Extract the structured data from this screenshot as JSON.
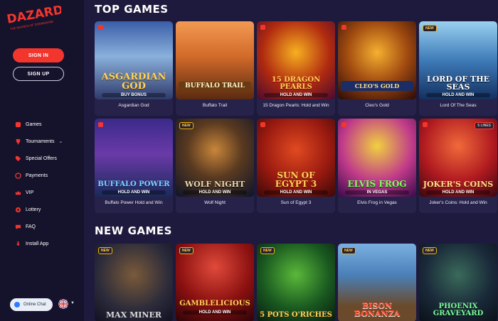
{
  "brand": {
    "name": "DAZARD",
    "tagline": "THE RAVINGS OF DONNRAVINE",
    "accent": "#f2362e"
  },
  "auth": {
    "signin_label": "SIGN IN",
    "signup_label": "SIGN UP"
  },
  "nav": [
    {
      "label": "Games",
      "icon": "dice-icon"
    },
    {
      "label": "Tournaments",
      "icon": "trophy-icon"
    },
    {
      "label": "Special Offers",
      "icon": "tag-icon"
    },
    {
      "label": "Payments",
      "icon": "wallet-icon"
    },
    {
      "label": "VIP",
      "icon": "crown-icon"
    },
    {
      "label": "Lottery",
      "icon": "lottery-icon"
    },
    {
      "label": "FAQ",
      "icon": "question-icon"
    },
    {
      "label": "Install App",
      "icon": "download-icon"
    }
  ],
  "chat": {
    "label": "Online Chat"
  },
  "sections": {
    "top_games": "TOP GAMES",
    "new_games": "NEW GAMES"
  },
  "top_games": [
    {
      "name": "Asgardian God",
      "title": "ASGARDIAN GOD",
      "sub": "BUY BONUS",
      "badge": "star"
    },
    {
      "name": "Buffalo Trail",
      "title": "BUFFALO TRAIL",
      "sub": "",
      "badge": ""
    },
    {
      "name": "15 Dragon Pearls: Hold and Win",
      "title": "15 DRAGON PEARLS",
      "sub": "HOLD AND WIN",
      "badge": "star"
    },
    {
      "name": "Cleo's Gold",
      "title": "CLEO'S GOLD",
      "sub": "",
      "badge": "star"
    },
    {
      "name": "Lord Of The Seas",
      "title": "LORD OF THE SEAS",
      "sub": "HOLD AND WIN",
      "badge": "NEW"
    },
    {
      "name": "Buffalo Power Hold and Win",
      "title": "BUFFALO POWER",
      "sub": "HOLD AND WIN",
      "badge": "star"
    },
    {
      "name": "Wolf Night",
      "title": "WOLF NIGHT",
      "sub": "HOLD AND WIN",
      "badge": "NEW"
    },
    {
      "name": "Sun of Egypt 3",
      "title": "SUN OF EGYPT 3",
      "sub": "HOLD AND WIN",
      "badge": "star"
    },
    {
      "name": "Elvis Frog in Vegas",
      "title": "ELVIS FROG",
      "sub": "IN VEGAS",
      "badge": "star"
    },
    {
      "name": "Joker's Coins: Hold and Win",
      "title": "JOKER'S COINS",
      "sub": "HOLD AND WIN",
      "badge": "star",
      "lines": "5 LINES"
    }
  ],
  "new_games": [
    {
      "title": "MAX MINER",
      "sub": "",
      "badge": "NEW"
    },
    {
      "title": "GAMBLELICIOUS",
      "sub": "HOLD AND WIN",
      "badge": "NEW"
    },
    {
      "title": "5 POTS O'RICHES",
      "sub": "",
      "badge": "NEW"
    },
    {
      "title": "BISON BONANZA",
      "sub": "",
      "badge": "NEW"
    },
    {
      "title": "PHOENIX GRAVEYARD",
      "sub": "",
      "badge": "NEW"
    }
  ],
  "new_badge": "NEW"
}
